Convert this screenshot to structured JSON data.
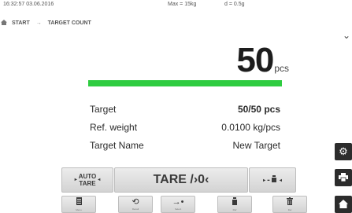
{
  "status": {
    "datetime": "16:32:57 03.06.2016",
    "max": "Max = 15kg",
    "d": "d = 0.5g"
  },
  "breadcrumb": {
    "start": "START",
    "current": "TARGET COUNT"
  },
  "display": {
    "value": "50",
    "unit": "pcs",
    "progress": 1.0,
    "progress_color": "#2ecc40"
  },
  "info": {
    "rows": [
      {
        "label": "Target",
        "value": "50/50 pcs"
      },
      {
        "label": "Ref. weight",
        "value": "0.0100 kg/pcs"
      },
      {
        "label": "Target Name",
        "value": "New Target"
      }
    ]
  },
  "buttons": {
    "auto_line1": "AUTO",
    "auto_line2": "TARE",
    "tare": "TARE /›0‹",
    "piece_dash": "-"
  },
  "bottom": {
    "menu_label": "Menu",
    "recall_label": "Recall",
    "select_label": "Select",
    "piece_label": "Ref",
    "delete_label": "Del"
  },
  "icons": {
    "home": "home-icon",
    "arrow": "arrow-right-icon",
    "gear": "gear-icon",
    "print": "printer-icon",
    "house": "home-icon"
  }
}
